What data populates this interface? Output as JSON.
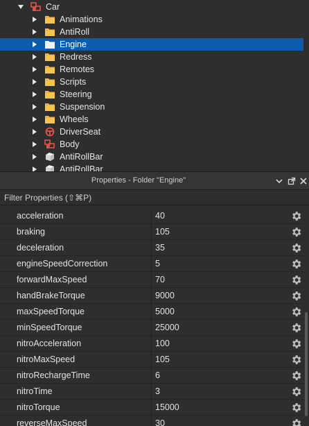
{
  "explorer": {
    "root": {
      "label": "Car",
      "icon": "model-icon"
    },
    "items": [
      {
        "label": "Animations",
        "icon": "folder-icon",
        "selected": false
      },
      {
        "label": "AntiRoll",
        "icon": "folder-icon",
        "selected": false
      },
      {
        "label": "Engine",
        "icon": "folder-icon",
        "selected": true
      },
      {
        "label": "Redress",
        "icon": "folder-icon",
        "selected": false
      },
      {
        "label": "Remotes",
        "icon": "folder-icon",
        "selected": false
      },
      {
        "label": "Scripts",
        "icon": "folder-icon",
        "selected": false
      },
      {
        "label": "Steering",
        "icon": "folder-icon",
        "selected": false
      },
      {
        "label": "Suspension",
        "icon": "folder-icon",
        "selected": false
      },
      {
        "label": "Wheels",
        "icon": "folder-icon",
        "selected": false
      },
      {
        "label": "DriverSeat",
        "icon": "vehicle-seat-icon",
        "selected": false
      },
      {
        "label": "Body",
        "icon": "model-icon",
        "selected": false
      },
      {
        "label": "AntiRollBar",
        "icon": "part-icon",
        "selected": false
      },
      {
        "label": "AntiRollBar",
        "icon": "part-icon",
        "selected": false
      }
    ]
  },
  "properties": {
    "title": "Properties - Folder \"Engine\"",
    "filter_placeholder": "Filter Properties (⇧⌘P)",
    "rows": [
      {
        "name": "acceleration",
        "value": "40"
      },
      {
        "name": "braking",
        "value": "105"
      },
      {
        "name": "deceleration",
        "value": "35"
      },
      {
        "name": "engineSpeedCorrection",
        "value": "5"
      },
      {
        "name": "forwardMaxSpeed",
        "value": "70"
      },
      {
        "name": "handBrakeTorque",
        "value": "9000"
      },
      {
        "name": "maxSpeedTorque",
        "value": "5000"
      },
      {
        "name": "minSpeedTorque",
        "value": "25000"
      },
      {
        "name": "nitroAcceleration",
        "value": "100"
      },
      {
        "name": "nitroMaxSpeed",
        "value": "105"
      },
      {
        "name": "nitroRechargeTime",
        "value": "6"
      },
      {
        "name": "nitroTime",
        "value": "3"
      },
      {
        "name": "nitroTorque",
        "value": "15000"
      },
      {
        "name": "reverseMaxSpeed",
        "value": "30"
      }
    ]
  },
  "colors": {
    "selection": "#0b5cad",
    "folder": "#f2b53a",
    "model": "#e8504a",
    "background": "#2e2e2e"
  }
}
